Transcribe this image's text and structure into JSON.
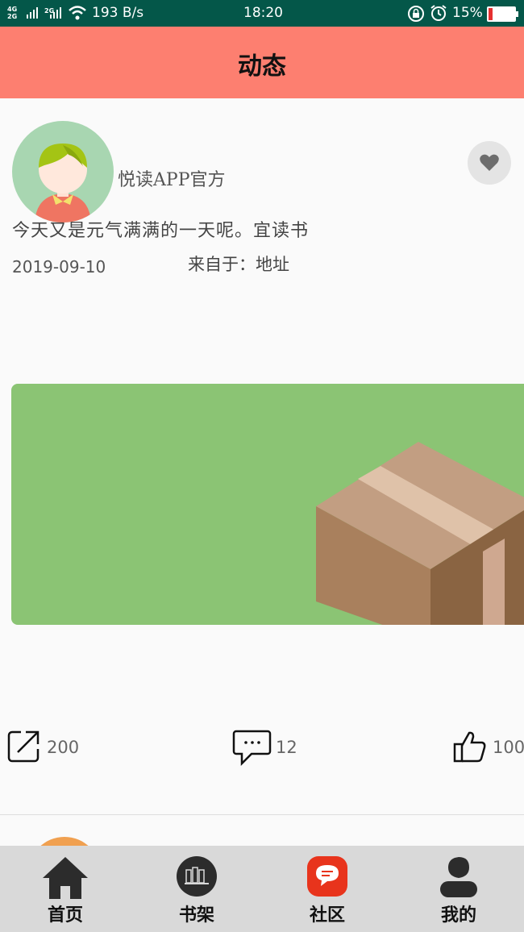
{
  "status_bar": {
    "net_speed": "193 B/s",
    "time": "18:20",
    "battery": "15%",
    "network_labels": [
      "4G",
      "2G",
      "2G"
    ]
  },
  "header": {
    "title": "动态"
  },
  "post": {
    "username": "悦读APP官方",
    "content": "今天又是元气满满的一天呢。宜读书",
    "date": "2019-09-10",
    "from": "来自于：地址",
    "shares": "200",
    "comments": "12",
    "likes": "100"
  },
  "tabs": [
    {
      "label": "首页",
      "icon": "home-icon"
    },
    {
      "label": "书架",
      "icon": "bookshelf-icon"
    },
    {
      "label": "社区",
      "icon": "community-icon"
    },
    {
      "label": "我的",
      "icon": "profile-icon"
    }
  ],
  "colors": {
    "status_bar": "#045749",
    "header": "#fd7f70",
    "image_bg": "#8bc474",
    "tab_bar": "#d9d9d9",
    "community_active": "#e8341c"
  }
}
